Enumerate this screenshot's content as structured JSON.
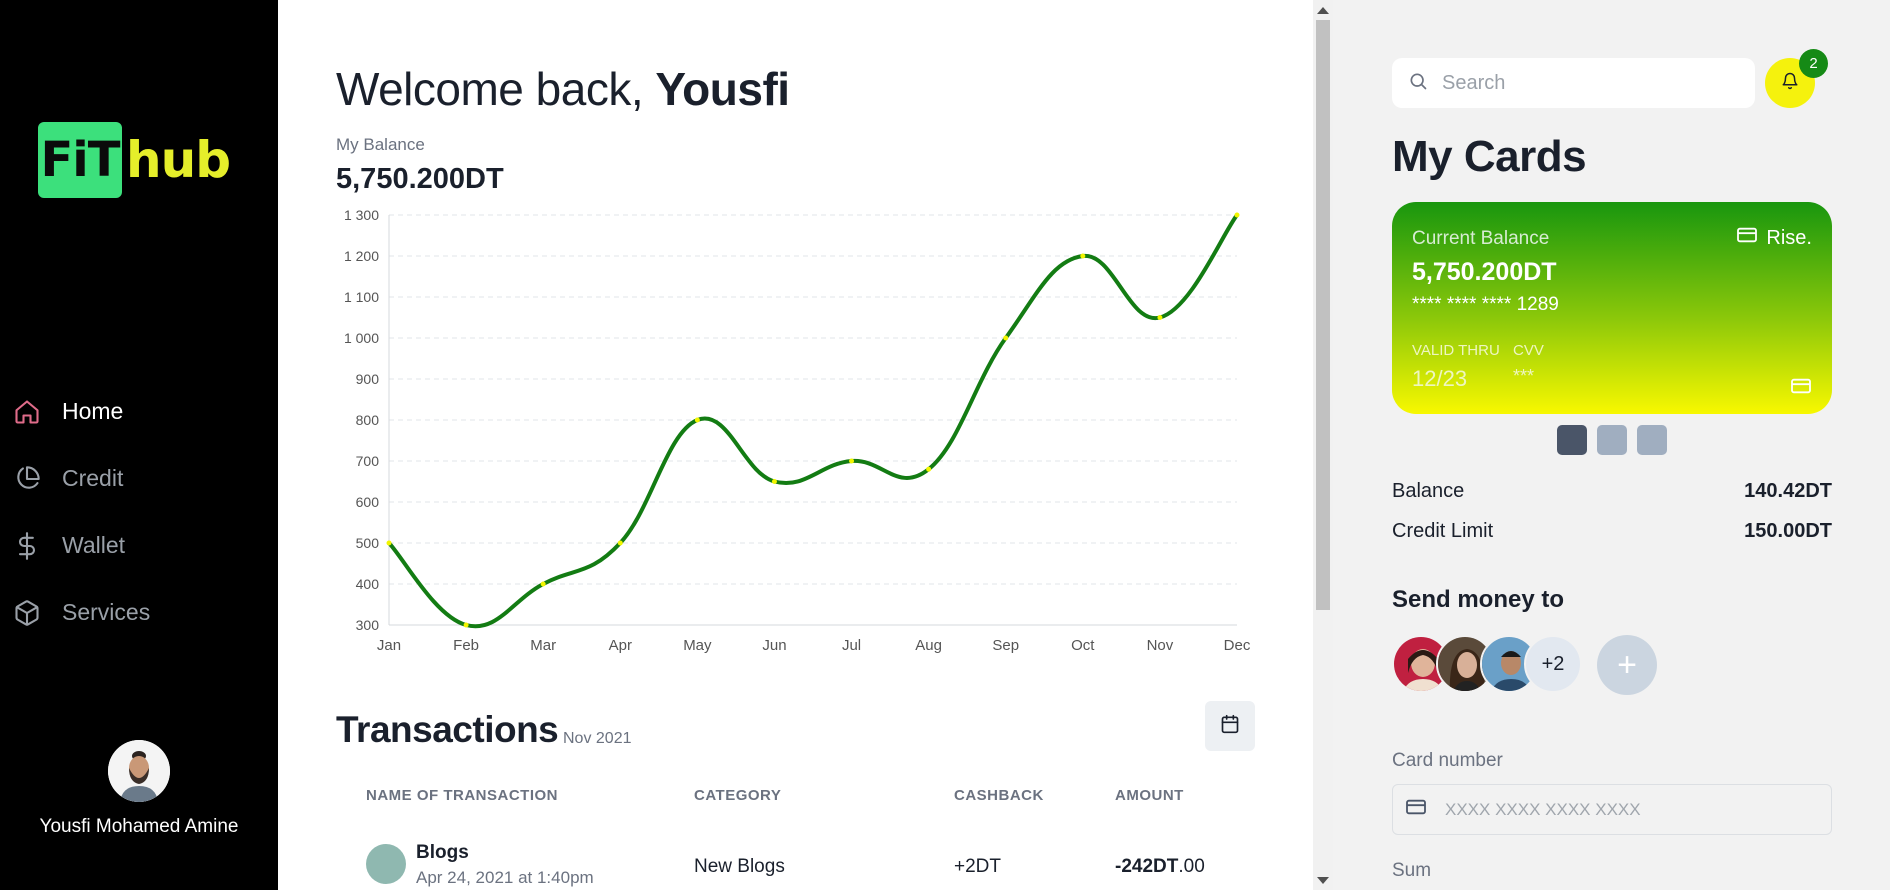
{
  "sidebar": {
    "logo": {
      "part1": "FiT",
      "part2": "hub"
    },
    "items": [
      {
        "label": "Home",
        "icon": "home-icon",
        "active": true
      },
      {
        "label": "Credit",
        "icon": "pie-chart-icon",
        "active": false
      },
      {
        "label": "Wallet",
        "icon": "dollar-icon",
        "active": false
      },
      {
        "label": "Services",
        "icon": "box-icon",
        "active": false
      }
    ],
    "profile": {
      "name": "Yousfi Mohamed Amine"
    }
  },
  "main": {
    "welcome_prefix": "Welcome back, ",
    "welcome_name": "Yousfi",
    "balance_label": "My Balance",
    "balance_value": "5,750.200DT"
  },
  "chart_data": {
    "type": "line",
    "categories": [
      "Jan",
      "Feb",
      "Mar",
      "Apr",
      "May",
      "Jun",
      "Jul",
      "Aug",
      "Sep",
      "Oct",
      "Nov",
      "Dec"
    ],
    "series": [
      {
        "values": [
          500,
          300,
          400,
          500,
          800,
          650,
          700,
          680,
          1000,
          1200,
          1050,
          1300
        ]
      }
    ],
    "yticks": [
      "300",
      "400",
      "500",
      "600",
      "700",
      "800",
      "900",
      "1 000",
      "1 100",
      "1 200",
      "1 300"
    ],
    "ylim": [
      300,
      1300
    ],
    "grid": true,
    "line_color": "#137c13",
    "point_color": "#f1f500"
  },
  "transactions": {
    "title": "Transactions",
    "date": "Nov 2021",
    "headers": [
      "NAME OF TRANSACTION",
      "CATEGORY",
      "CASHBACK",
      "AMOUNT"
    ],
    "rows": [
      {
        "name": "Blogs",
        "date": "Apr 24, 2021 at 1:40pm",
        "category": "New Blogs",
        "cashback": "+2DT",
        "amount_main": "-242DT",
        "amount_dec": ".00"
      }
    ]
  },
  "right": {
    "search_placeholder": "Search",
    "notification_count": "2",
    "my_cards_title": "My Cards",
    "card": {
      "balance_label": "Current Balance",
      "brand": "Rise.",
      "balance_value": "5,750.200DT",
      "number_mask": "**** **** ****",
      "number_last": "1289",
      "valid_label": "VALID THRU",
      "valid_value": "12/23",
      "cvv_label": "CVV",
      "cvv_value": "***"
    },
    "balance_label": "Balance",
    "balance_value": "140.42DT",
    "credit_limit_label": "Credit Limit",
    "credit_limit_value": "150.00DT",
    "send_title": "Send money to",
    "more_count": "+2",
    "add_symbol": "+",
    "card_number_label": "Card number",
    "card_number_placeholder": "XXXX XXXX XXXX XXXX",
    "sum_label": "Sum"
  },
  "colors": {
    "sidebar_bg": "#000000",
    "accent_green": "#137c13",
    "accent_yellow": "#f5f20d",
    "logo_green": "#3ce07c",
    "logo_yellow": "#e5ee2a"
  }
}
